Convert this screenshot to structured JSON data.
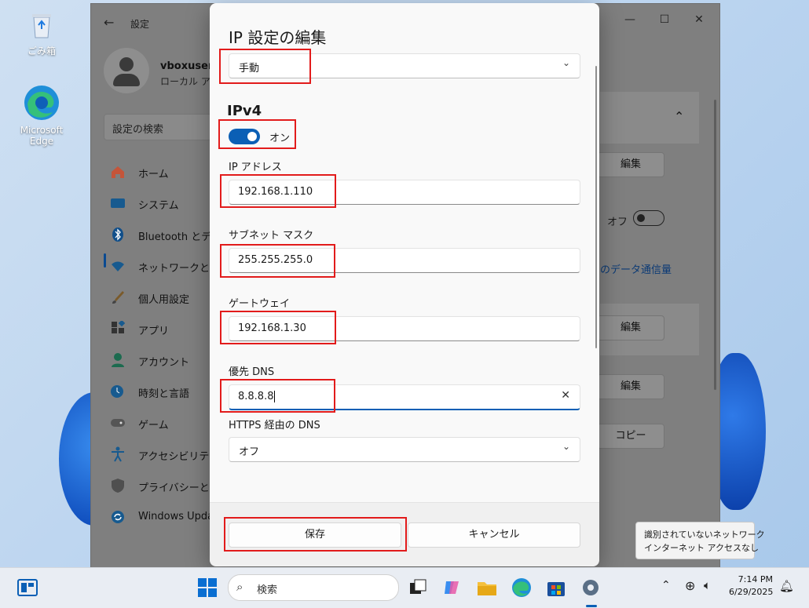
{
  "desktop": {
    "icons": [
      {
        "label": "ごみ箱",
        "icon": "recycle-bin-icon"
      },
      {
        "label": "Microsoft Edge",
        "icon": "edge-icon"
      }
    ]
  },
  "settings_window": {
    "title": "設定",
    "user": {
      "name": "vboxuser",
      "subtitle": "ローカル アカウ"
    },
    "search_placeholder": "設定の検索",
    "nav": [
      {
        "label": "ホーム",
        "icon": "home-icon"
      },
      {
        "label": "システム",
        "icon": "system-icon"
      },
      {
        "label": "Bluetooth とデバ",
        "icon": "bluetooth-icon"
      },
      {
        "label": "ネットワークとイン",
        "icon": "network-icon",
        "selected": true
      },
      {
        "label": "個人用設定",
        "icon": "brush-icon"
      },
      {
        "label": "アプリ",
        "icon": "apps-icon"
      },
      {
        "label": "アカウント",
        "icon": "account-icon"
      },
      {
        "label": "時刻と言語",
        "icon": "clock-language-icon"
      },
      {
        "label": "ゲーム",
        "icon": "gamepad-icon"
      },
      {
        "label": "アクセシビリティ",
        "icon": "accessibility-icon"
      },
      {
        "label": "プライバシーとセキ",
        "icon": "shield-icon"
      },
      {
        "label": "Windows Upda",
        "icon": "update-icon"
      }
    ],
    "right": {
      "edit_label": "編集",
      "off_label": "オフ",
      "data_usage_link": "のデータ通信量",
      "copy_label": "コピー"
    }
  },
  "dialog": {
    "title": "IP 設定の編集",
    "mode": "手動",
    "section": "IPv4",
    "toggle_label": "オン",
    "toggle_on": true,
    "fields": {
      "ip_label": "IP アドレス",
      "ip_value": "192.168.1.110",
      "subnet_label": "サブネット マスク",
      "subnet_value": "255.255.255.0",
      "gateway_label": "ゲートウェイ",
      "gateway_value": "192.168.1.30",
      "dns_label": "優先 DNS",
      "dns_value": "8.8.8.8"
    },
    "https_label": "HTTPS 経由の DNS",
    "https_value": "オフ",
    "save_label": "保存",
    "cancel_label": "キャンセル"
  },
  "tooltip": {
    "line1": "識別されていないネットワーク",
    "line2": "インターネット アクセスなし"
  },
  "taskbar": {
    "search_placeholder": "検索",
    "time": "7:14 PM",
    "date": "6/29/2025"
  },
  "colors": {
    "accent": "#0b5fb5",
    "highlight_box": "#e21b1b"
  }
}
